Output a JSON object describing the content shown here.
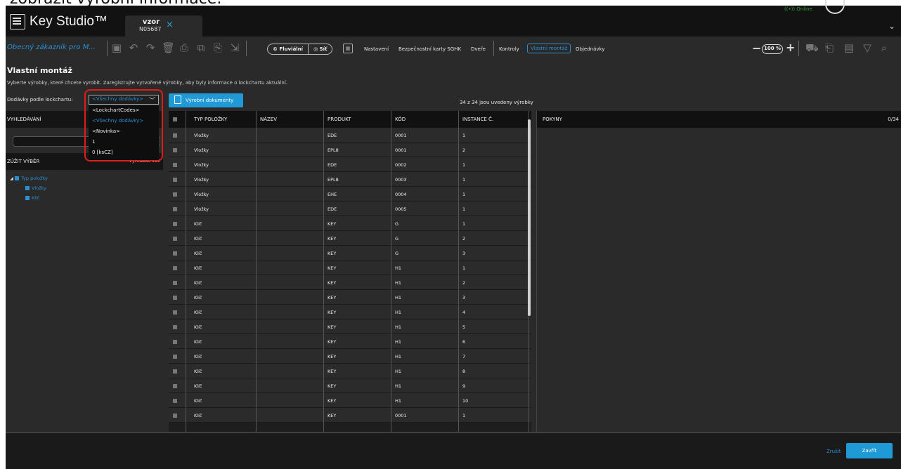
{
  "banner_text": "zobrazit výrobní informace.",
  "app": {
    "name": "Key Studio™",
    "tab_line1": "vzor",
    "tab_line2": "N05687",
    "online_status": "((•)) Online"
  },
  "toolbar": {
    "customer": "Obecný zákazník pro M...",
    "seg_fluvialni": "© Fluviální",
    "seg_sit": "◎ Síť",
    "menu": {
      "nastaveni": "Nastavení",
      "bezpecnostni": "Bezpečnostní karty SGHK",
      "dvere": "Dveře",
      "kontroly": "Kontroly",
      "vlastni_montaz": "Vlastní montáž",
      "objednavky": "Objednávky"
    },
    "zoom": "100 %"
  },
  "page": {
    "title": "Vlastní montáž",
    "subtitle": "Vyberte výrobky, které chcete vyrobit. Zaregistrujte vytvořené výrobky, aby byly informace o lockchartu aktuální."
  },
  "filter": {
    "label": "Dodávky podle lockchartu:",
    "selected": "<Všechny dodávky>",
    "options": [
      "<LockchartCodes>",
      "<Všechny dodávky>",
      "<Novinka>",
      "1",
      "0 [ksCZ]"
    ]
  },
  "production_docs_button": "Výrobní dokumenty",
  "count_text": "34 z 34 jsou uvedeny výrobky",
  "left_panel": {
    "search_header": "VYHLEDÁVÁNÍ",
    "narrow_header": "ZÚŽIT VÝBĚR",
    "clear_all": "Vymazat vše",
    "tree_root": "Typ položky",
    "tree_children": [
      "Vložky",
      "Klíč"
    ]
  },
  "table": {
    "columns": [
      "TYP POLOŽKY",
      "NÁZEV",
      "PRODUKT",
      "KÓD",
      "INSTANCE Č."
    ],
    "rows": [
      {
        "type": "Vložky",
        "name": "",
        "product": "EDE",
        "code": "0001",
        "instance": "1"
      },
      {
        "type": "Vložky",
        "name": "",
        "product": "EPL8",
        "code": "0001",
        "instance": "2"
      },
      {
        "type": "Vložky",
        "name": "",
        "product": "EDE",
        "code": "0002",
        "instance": "1"
      },
      {
        "type": "Vložky",
        "name": "",
        "product": "EPL8",
        "code": "0003",
        "instance": "1"
      },
      {
        "type": "Vložky",
        "name": "",
        "product": "EHE",
        "code": "0004",
        "instance": "1"
      },
      {
        "type": "Vložky",
        "name": "",
        "product": "EDE",
        "code": "0005",
        "instance": "1"
      },
      {
        "type": "Klíč",
        "name": "",
        "product": "KEY",
        "code": "G",
        "instance": "1"
      },
      {
        "type": "Klíč",
        "name": "",
        "product": "KEY",
        "code": "G",
        "instance": "2"
      },
      {
        "type": "Klíč",
        "name": "",
        "product": "KEY",
        "code": "G",
        "instance": "3"
      },
      {
        "type": "Klíč",
        "name": "",
        "product": "KEY",
        "code": "H1",
        "instance": "1"
      },
      {
        "type": "Klíč",
        "name": "",
        "product": "KEY",
        "code": "H1",
        "instance": "2"
      },
      {
        "type": "Klíč",
        "name": "",
        "product": "KEY",
        "code": "H1",
        "instance": "3"
      },
      {
        "type": "Klíč",
        "name": "",
        "product": "KEY",
        "code": "H1",
        "instance": "4"
      },
      {
        "type": "Klíč",
        "name": "",
        "product": "KEY",
        "code": "H1",
        "instance": "5"
      },
      {
        "type": "Klíč",
        "name": "",
        "product": "KEY",
        "code": "H1",
        "instance": "6"
      },
      {
        "type": "Klíč",
        "name": "",
        "product": "KEY",
        "code": "H1",
        "instance": "7"
      },
      {
        "type": "Klíč",
        "name": "",
        "product": "KEY",
        "code": "H1",
        "instance": "8"
      },
      {
        "type": "Klíč",
        "name": "",
        "product": "KEY",
        "code": "H1",
        "instance": "9"
      },
      {
        "type": "Klíč",
        "name": "",
        "product": "KEY",
        "code": "H1",
        "instance": "10"
      },
      {
        "type": "Klíč",
        "name": "",
        "product": "KEY",
        "code": "0001",
        "instance": "1"
      }
    ]
  },
  "right_panel": {
    "header": "POKYNY",
    "count": "0/34"
  },
  "footer": {
    "cancel": "Zrušit",
    "close": "Zavřít"
  },
  "colors": {
    "accent": "#1f9ad6",
    "highlight": "#e21b1b",
    "panel": "#2a2a2a"
  }
}
